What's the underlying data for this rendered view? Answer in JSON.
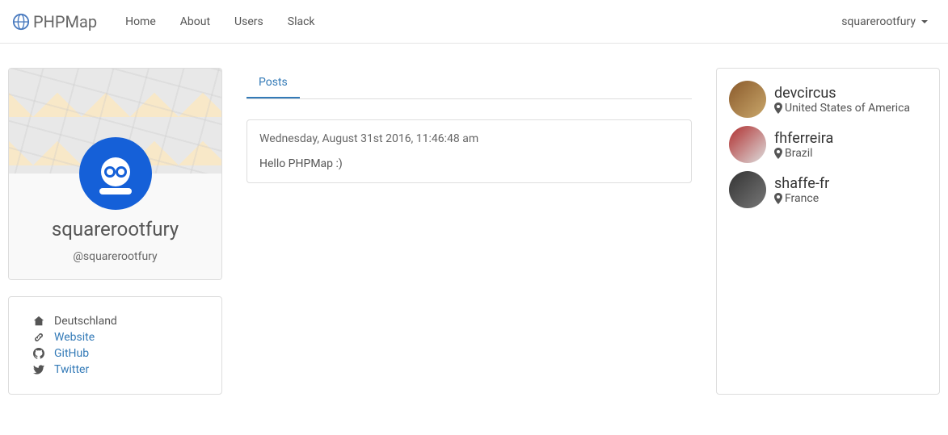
{
  "brand": "PHPMap",
  "nav": {
    "home": "Home",
    "about": "About",
    "users": "Users",
    "slack": "Slack"
  },
  "currentUser": "squarerootfury",
  "profile": {
    "displayName": "squarerootfury",
    "handle": "@squarerootfury",
    "location": "Deutschland",
    "links": {
      "website": "Website",
      "github": "GitHub",
      "twitter": "Twitter"
    }
  },
  "tabs": {
    "posts": "Posts"
  },
  "posts": [
    {
      "date": "Wednesday, August 31st 2016, 11:46:48 am",
      "body": "Hello PHPMap :)"
    }
  ],
  "suggested": [
    {
      "name": "devcircus",
      "location": "United States of America"
    },
    {
      "name": "fhferreira",
      "location": "Brazil"
    },
    {
      "name": "shaffe-fr",
      "location": "France"
    }
  ]
}
